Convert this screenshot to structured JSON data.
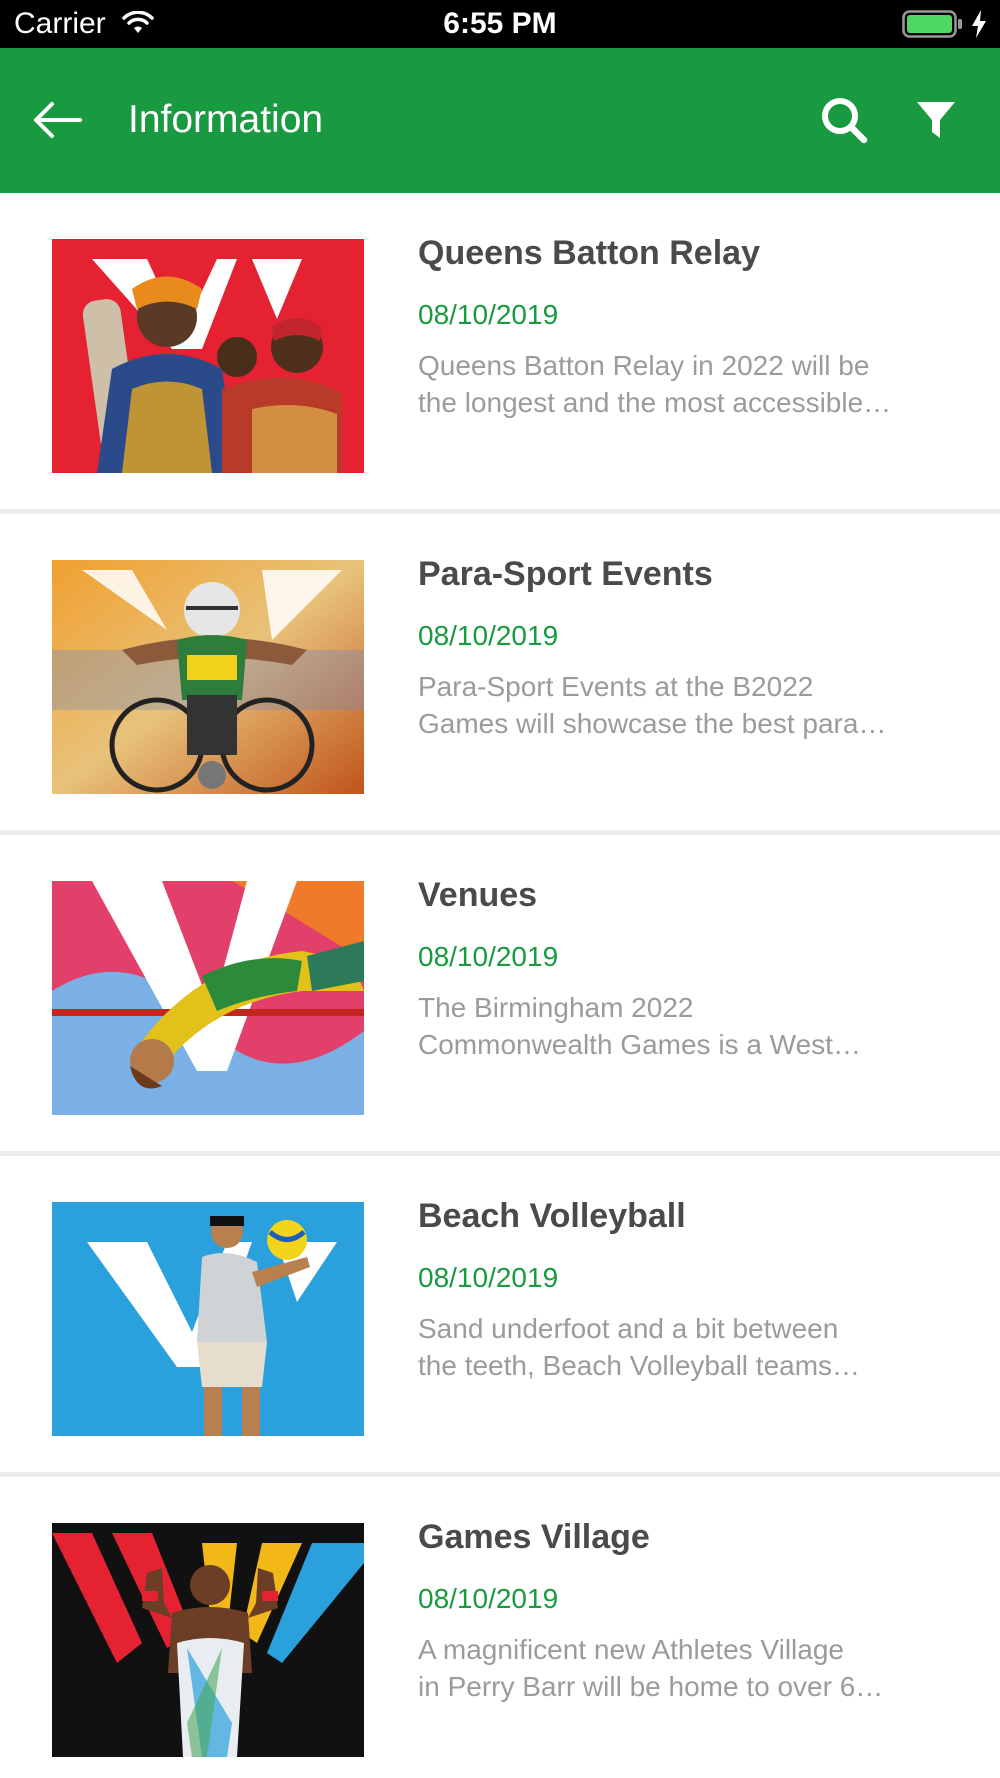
{
  "status_bar": {
    "carrier": "Carrier",
    "time": "6:55 PM"
  },
  "nav": {
    "title": "Information"
  },
  "colors": {
    "accent": "#1a9a40",
    "title_text": "#4a4a4a",
    "body_text": "#9b9b9b"
  },
  "items": [
    {
      "title": "Queens Batton Relay",
      "date": "08/10/2019",
      "desc_line1": "Queens Batton Relay in 2022 will be",
      "desc_line2": "the longest and the most accessible…",
      "image": "women-holding-baton-photo"
    },
    {
      "title": "Para-Sport Events",
      "date": "08/10/2019",
      "desc_line1": "Para-Sport Events at the B2022",
      "desc_line2": "Games will showcase the best para…",
      "image": "wheelchair-racer-photo"
    },
    {
      "title": "Venues",
      "date": "08/10/2019",
      "desc_line1": "The Birmingham 2022",
      "desc_line2": "Commonwealth Games is a West…",
      "image": "high-jumper-photo"
    },
    {
      "title": "Beach Volleyball",
      "date": "08/10/2019",
      "desc_line1": "Sand underfoot and a bit between",
      "desc_line2": "the teeth, Beach Volleyball teams…",
      "image": "volleyball-player-photo"
    },
    {
      "title": "Games Village",
      "date": "08/10/2019",
      "desc_line1": "A magnificent new Athletes Village",
      "desc_line2": "in Perry Barr will be home to over 6…",
      "image": "gymnast-flexing-photo"
    }
  ]
}
